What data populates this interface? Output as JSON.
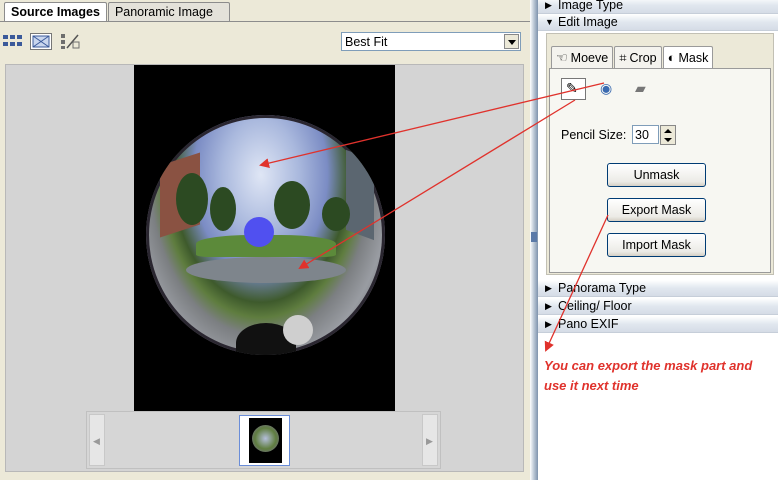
{
  "left_tabs": [
    {
      "label": "Source Images",
      "active": true
    },
    {
      "label": "Panoramic Image",
      "active": false
    }
  ],
  "toolbar": {
    "icons": [
      "grid-view-icon",
      "image-view-icon",
      "list-view-icon"
    ],
    "fit_select": {
      "value": "Best Fit"
    }
  },
  "thumbnails": {
    "count": 1,
    "prev_glyph": "◀",
    "next_glyph": "▶"
  },
  "right_sections": {
    "image_type": "Image Type",
    "edit_image": "Edit Image",
    "panorama_type": "Panorama Type",
    "ceiling_floor": "Ceiling/ Floor",
    "pano_exif": "Pano EXIF"
  },
  "edit_tabs": [
    {
      "label": "Moeve",
      "icon": "hand-icon",
      "glyph": "☜",
      "active": false
    },
    {
      "label": "Crop",
      "icon": "crop-icon",
      "glyph": "⌗",
      "active": false
    },
    {
      "label": "Mask",
      "icon": "mask-icon",
      "glyph": "◐",
      "active": true
    }
  ],
  "mask_tools": [
    {
      "icon": "pencil-icon",
      "glyph": "✎",
      "selected": true
    },
    {
      "icon": "eye-icon",
      "glyph": "◉",
      "selected": false
    },
    {
      "icon": "eraser-icon",
      "glyph": "▰",
      "selected": false
    }
  ],
  "pencil_size": {
    "label": "Pencil Size:",
    "value": "30"
  },
  "buttons": {
    "unmask": "Unmask",
    "export_mask": "Export Mask",
    "import_mask": "Import Mask"
  },
  "annotation": {
    "text": "You can export the mask part and use it next time",
    "color": "#e0322c"
  },
  "mask_colors": {
    "blue": "#5050f0",
    "grey": "#cfcfcf"
  }
}
